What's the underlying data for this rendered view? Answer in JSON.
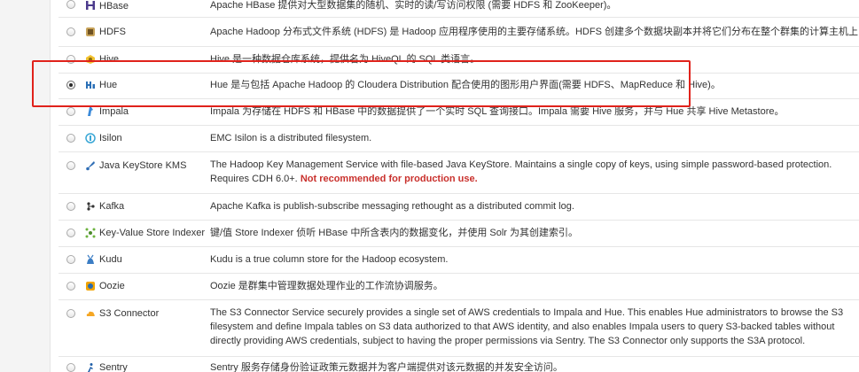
{
  "services": [
    {
      "name": "HBase",
      "icon": "hbase-icon",
      "selected": false,
      "description": "Apache HBase 提供对大型数据集的随机、实时的读/写访问权限 (需要 HDFS 和 ZooKeeper)。"
    },
    {
      "name": "HDFS",
      "icon": "hdfs-icon",
      "selected": false,
      "description": "Apache Hadoop 分布式文件系统 (HDFS) 是 Hadoop 应用程序使用的主要存储系统。HDFS 创建多个数据块副本并将它们分布在整个群集的计算主机上，以启用可靠且极其快速的计算功能"
    },
    {
      "name": "Hive",
      "icon": "hive-icon",
      "selected": false,
      "description": "Hive 是一种数据仓库系统，提供名为 HiveQL 的 SQL 类语言。"
    },
    {
      "name": "Hue",
      "icon": "hue-icon",
      "selected": true,
      "description": "Hue 是与包括 Apache Hadoop 的 Cloudera Distribution 配合使用的图形用户界面(需要 HDFS、MapReduce 和 Hive)。"
    },
    {
      "name": "Impala",
      "icon": "impala-icon",
      "selected": false,
      "description": "Impala 为存储在 HDFS 和 HBase 中的数据提供了一个实时 SQL 查询接口。Impala 需要 Hive 服务，并与 Hue 共享 Hive Metastore。"
    },
    {
      "name": "Isilon",
      "icon": "isilon-icon",
      "selected": false,
      "description": "EMC Isilon is a distributed filesystem."
    },
    {
      "name": "Java KeyStore KMS",
      "icon": "java-keystore-icon",
      "selected": false,
      "description": "The Hadoop Key Management Service with file-based Java KeyStore. Maintains a single copy of keys, using simple password-based protection. Requires CDH 6.0+.",
      "warning": "Not recommended for production use."
    },
    {
      "name": "Kafka",
      "icon": "kafka-icon",
      "selected": false,
      "description": "Apache Kafka is publish-subscribe messaging rethought as a distributed commit log."
    },
    {
      "name": "Key-Value Store Indexer",
      "icon": "key-value-store-indexer-icon",
      "selected": false,
      "description": "键/值 Store Indexer 侦听 HBase 中所含表内的数据变化，并使用 Solr 为其创建索引。"
    },
    {
      "name": "Kudu",
      "icon": "kudu-icon",
      "selected": false,
      "description": "Kudu is a true column store for the Hadoop ecosystem."
    },
    {
      "name": "Oozie",
      "icon": "oozie-icon",
      "selected": false,
      "description": "Oozie 是群集中管理数据处理作业的工作流协调服务。"
    },
    {
      "name": "S3 Connector",
      "icon": "s3-connector-icon",
      "selected": false,
      "description": "The S3 Connector Service securely provides a single set of AWS credentials to Impala and Hue. This enables Hue administrators to browse the S3 filesystem and define Impala tables on S3 data authorized to that AWS identity, and also enables Impala users to query S3-backed tables without directly providing AWS credentials, subject to having the proper permissions via Sentry. The S3 Connector only supports the S3A protocol."
    },
    {
      "name": "Sentry",
      "icon": "sentry-icon",
      "selected": false,
      "description": "Sentry 服务存储身份验证政策元数据并为客户端提供对该元数据的并发安全访问。"
    }
  ],
  "colors": {
    "highlight": "#e0221b",
    "warning": "#c9302c",
    "row_border": "#e6e6e6"
  }
}
